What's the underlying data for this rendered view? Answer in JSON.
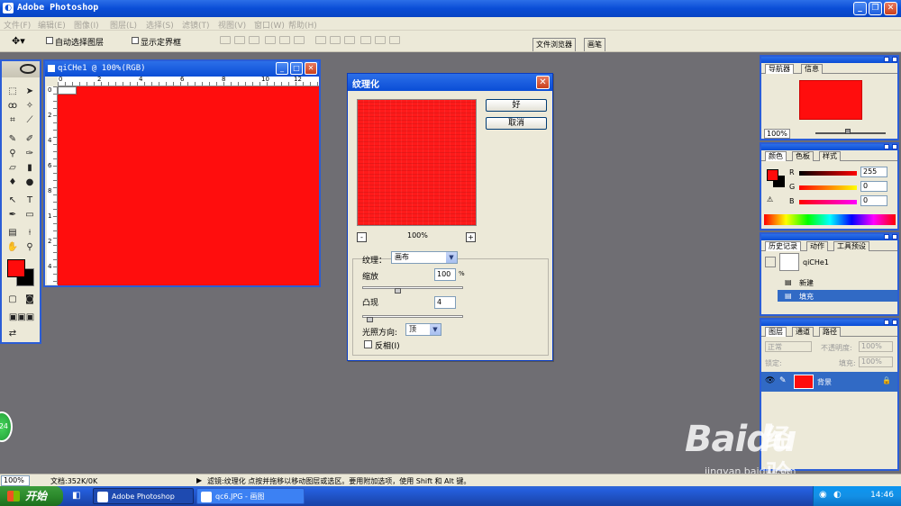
{
  "app": {
    "title": "Adobe Photoshop"
  },
  "menu": [
    "文件(F)",
    "编辑(E)",
    "图像(I)",
    "图层(L)",
    "选择(S)",
    "滤镜(T)",
    "视图(V)",
    "窗口(W)",
    "帮助(H)"
  ],
  "options": {
    "auto_select": "自动选择图层",
    "show_bounds": "显示定界框",
    "tab_file_browser": "文件浏览器",
    "tab_brushes": "画笔"
  },
  "document": {
    "title": "qiCHe1 @ 100%(RGB)",
    "ruler_h": [
      "0",
      "2",
      "4",
      "6",
      "8",
      "10",
      "12"
    ],
    "ruler_v": [
      "0",
      "2",
      "4",
      "6",
      "8",
      "1",
      "2",
      "4"
    ],
    "fill_color": "#ff0d0d"
  },
  "dialog": {
    "title": "纹理化",
    "ok": "好",
    "cancel": "取消",
    "zoom": "100%",
    "zoom_out": "-",
    "zoom_in": "+",
    "texture_label": "纹理：",
    "texture_value": "画布",
    "scale_label": "缩放",
    "scale_value": "100",
    "scale_unit": "%",
    "relief_label": "凸现",
    "relief_value": "4",
    "light_label": "光照方向:",
    "light_value": "顶",
    "invert_label": "反相(I)"
  },
  "navigator": {
    "tabs": [
      "导航器",
      "信息"
    ],
    "zoom": "100%"
  },
  "color": {
    "tabs": [
      "颜色",
      "色板",
      "样式"
    ],
    "r_label": "R",
    "r_value": "255",
    "g_label": "G",
    "g_value": "0",
    "b_label": "B",
    "b_value": "0"
  },
  "history": {
    "tabs": [
      "历史记录",
      "动作",
      "工具预设"
    ],
    "snapshot": "qiCHe1",
    "items": [
      "新建",
      "填充"
    ]
  },
  "layers": {
    "tabs": [
      "图层",
      "通道",
      "路径"
    ],
    "blend": "正常",
    "opacity_label": "不透明度:",
    "opacity_value": "100%",
    "lock_label": "锁定:",
    "fill_label": "填充:",
    "fill_value": "100%",
    "layer_name": "背景"
  },
  "status": {
    "zoom": "100%",
    "doc": "文档:352K/0K",
    "hint": "滤镜:纹理化  点按并拖移以移动图层或选区。要用附加选项，使用 Shift 和 Alt 键。"
  },
  "taskbar": {
    "start": "开始",
    "tasks": [
      "Adobe Photoshop",
      "qc6.JPG - 画图"
    ],
    "clock": "14:46"
  },
  "watermark": {
    "brand": "Baidu",
    "brand2": "经验",
    "url": "jingyan.baidu.com",
    "badge": "24"
  }
}
